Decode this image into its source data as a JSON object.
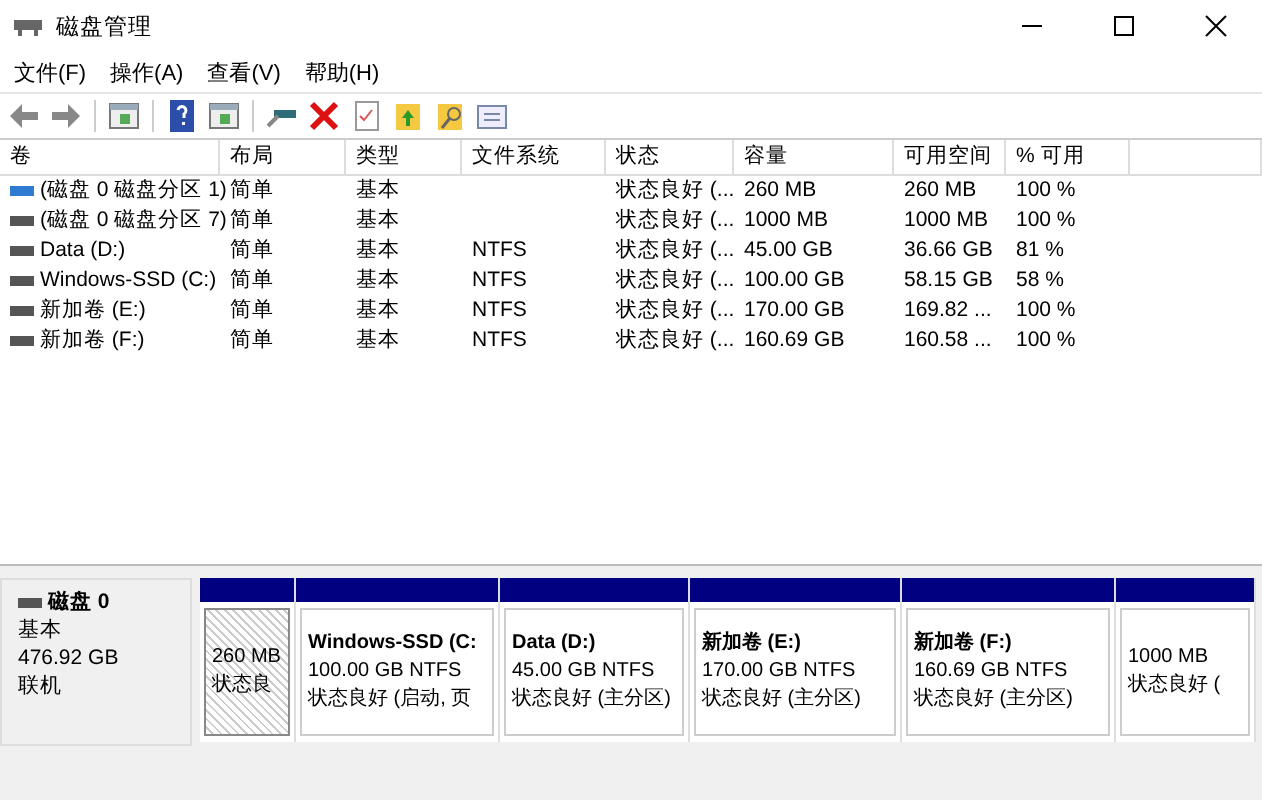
{
  "window": {
    "title": "磁盘管理"
  },
  "menu": [
    "文件(F)",
    "操作(A)",
    "查看(V)",
    "帮助(H)"
  ],
  "table": {
    "columns": [
      "卷",
      "布局",
      "类型",
      "文件系统",
      "状态",
      "容量",
      "可用空间",
      "% 可用"
    ],
    "rows": [
      {
        "color": "#2e7bd1",
        "cells": [
          "(磁盘 0 磁盘分区 1)",
          "简单",
          "基本",
          "",
          "状态良好 (...",
          "260 MB",
          "260 MB",
          "100 %"
        ]
      },
      {
        "color": "#555555",
        "cells": [
          "(磁盘 0 磁盘分区 7)",
          "简单",
          "基本",
          "",
          "状态良好 (...",
          "1000 MB",
          "1000 MB",
          "100 %"
        ]
      },
      {
        "color": "#555555",
        "cells": [
          "Data (D:)",
          "简单",
          "基本",
          "NTFS",
          "状态良好 (...",
          "45.00 GB",
          "36.66 GB",
          "81 %"
        ]
      },
      {
        "color": "#555555",
        "cells": [
          "Windows-SSD (C:)",
          "简单",
          "基本",
          "NTFS",
          "状态良好 (...",
          "100.00 GB",
          "58.15 GB",
          "58 %"
        ]
      },
      {
        "color": "#555555",
        "cells": [
          "新加卷 (E:)",
          "简单",
          "基本",
          "NTFS",
          "状态良好 (...",
          "170.00 GB",
          "169.82 ...",
          "100 %"
        ]
      },
      {
        "color": "#555555",
        "cells": [
          "新加卷 (F:)",
          "简单",
          "基本",
          "NTFS",
          "状态良好 (...",
          "160.69 GB",
          "160.58 ...",
          "100 %"
        ]
      }
    ]
  },
  "disk": {
    "name": "磁盘 0",
    "type": "基本",
    "size": "476.92 GB",
    "status": "联机",
    "partitions": [
      {
        "selected": true,
        "size": "260 MB",
        "status": "状态良"
      },
      {
        "selected": false,
        "name": "Windows-SSD  (C:",
        "size": "100.00 GB NTFS",
        "status": "状态良好 (启动, 页"
      },
      {
        "selected": false,
        "name": "Data  (D:)",
        "size": "45.00 GB NTFS",
        "status": "状态良好 (主分区)"
      },
      {
        "selected": false,
        "name": "新加卷  (E:)",
        "size": "170.00 GB NTFS",
        "status": "状态良好 (主分区)"
      },
      {
        "selected": false,
        "name": "新加卷  (F:)",
        "size": "160.69 GB NTFS",
        "status": "状态良好 (主分区)"
      },
      {
        "selected": false,
        "size": "1000 MB",
        "status": "状态良好 ("
      }
    ]
  }
}
